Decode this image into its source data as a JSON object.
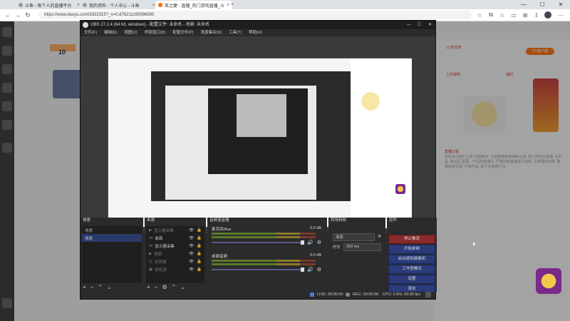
{
  "browser": {
    "tabs": [
      {
        "label": "斗鱼 - 每个人的直播平台",
        "active": false
      },
      {
        "label": "我的资料 - 个人中心 - 斗鱼",
        "active": false
      },
      {
        "label": "英之婕 - 直播_热门游戏直播_斗",
        "active": true
      }
    ],
    "new_tab": "+",
    "url": "https://www.douyu.com/3332315?_n=0.876211165996895",
    "window_controls": {
      "minimize": "—",
      "maximize": "☐",
      "close": "✕"
    }
  },
  "page": {
    "follow_count": "10",
    "right_links": [
      "公测/签到",
      "PC客户端",
      "上传视频",
      "福利"
    ],
    "notice_label": "直播公告:",
    "notice_text": "您好关注我们之单 的直播间, 斗鱼直播需要弹幕互动, 随心所欲大直播, 请礼品, 和社区 氛围，产品的直播间, 严禁利用直播进行违规, 注意理性消费, 警惕高频交易, 代练代充, 私下交易等行为"
  },
  "obs": {
    "title": "OBS 27.2.4 (64 bit, windows) - 配置文件: 未命名 - 场景: 未命名",
    "menu": [
      "文件(F)",
      "编辑(E)",
      "视图(V)",
      "停靠窗口(D)",
      "配置文件(P)",
      "场景集合(S)",
      "工具(T)",
      "帮助(H)"
    ],
    "docks": {
      "scenes": {
        "header": "场景",
        "column": "场景",
        "items": [
          "场景"
        ]
      },
      "sources": {
        "header": "来源",
        "items": [
          {
            "label": "显示器采集",
            "dim": true
          },
          {
            "label": "桌面",
            "dim": false
          },
          {
            "label": "显示器采集",
            "dim": false
          },
          {
            "label": "视频",
            "dim": true
          },
          {
            "label": "浏览器",
            "dim": true
          },
          {
            "label": "颜色源",
            "dim": true
          }
        ]
      },
      "mixer": {
        "header": "音频混音器",
        "channels": [
          {
            "label": "麦克风/Aux",
            "db": "0.0 dB"
          },
          {
            "label": "桌面音频",
            "db": "0.0 dB"
          }
        ]
      },
      "transitions": {
        "header": "转场特效",
        "type": "渐变",
        "duration_label": "时长",
        "duration_value": "300 ms"
      },
      "controls": {
        "header": "控件",
        "buttons": [
          "停止推流",
          "开始录制",
          "启动虚拟摄像机",
          "工作室模式",
          "设置",
          "退出"
        ]
      }
    },
    "filters_tab": "滤镜",
    "properties_tab": "属性",
    "status": {
      "live": "LIVE: 00:00:00",
      "rec": "REC: 00:00:00",
      "cpu": "CPU: 0.9%, 60.00 fps"
    }
  },
  "colors": {
    "accent": "#2a3a7a",
    "stop_button": "#8a2a2a",
    "brand_orange": "#ff6f00"
  }
}
